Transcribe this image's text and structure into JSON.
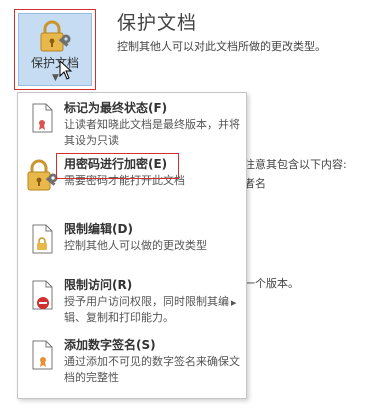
{
  "background": {
    "title": "保护文档",
    "description": "控制其他人可以对此文档所做的更改类型。",
    "fragment_1": "注意其包含以下内容:",
    "fragment_2": "者名",
    "fragment_3": "一个版本。"
  },
  "protect_button": {
    "label": "保护文档",
    "icon": "lock-key-icon"
  },
  "menu": {
    "items": [
      {
        "title": "标记为最终状态(F)",
        "description": "让读者知晓此文档是最终版本，并将其设为只读",
        "icon": "document-ribbon-icon"
      },
      {
        "title": "用密码进行加密(E)",
        "description": "需要密码才能打开此文档",
        "icon": "lock-key-icon"
      },
      {
        "title": "限制编辑(D)",
        "description": "控制其他人可以做的更改类型",
        "icon": "document-lock-icon"
      },
      {
        "title": "限制访问(R)",
        "description": "授予用户访问权限，同时限制其编辑、复制和打印能力。",
        "icon": "document-no-entry-icon",
        "has_submenu": true
      },
      {
        "title": "添加数字签名(S)",
        "description": "通过添加不可见的数字签名来确保文档的完整性",
        "icon": "document-signature-icon"
      }
    ]
  },
  "colors": {
    "button_bg": "#c5dcf3",
    "highlight_red": "#d32f2f",
    "lock_gold": "#e8b84a"
  }
}
